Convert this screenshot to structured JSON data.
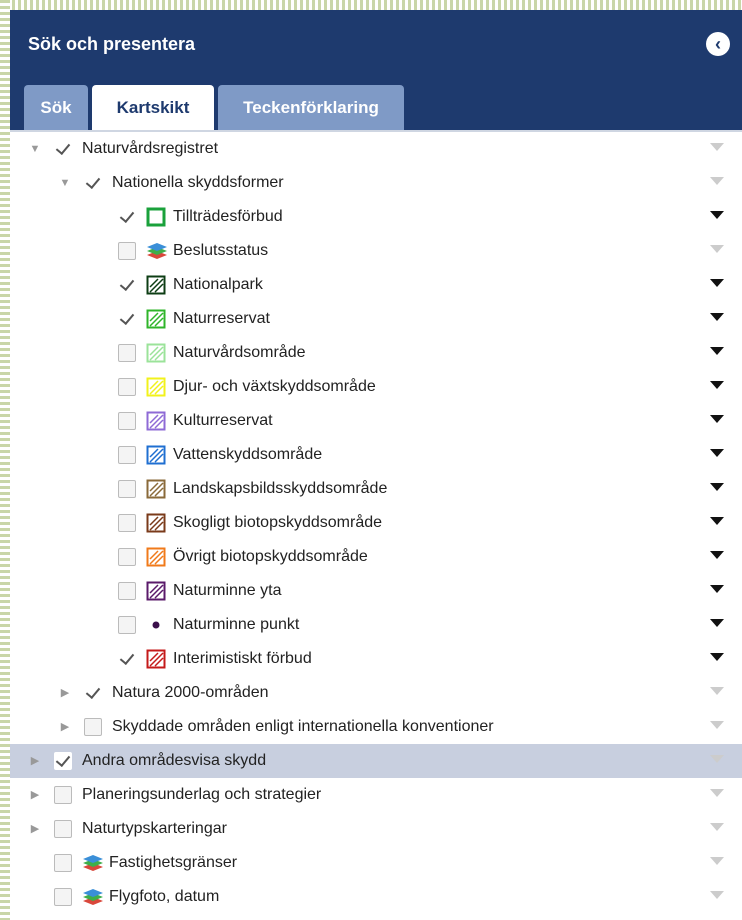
{
  "header": {
    "title": "Sök och presentera",
    "close_icon": "circle-chevron-left-icon"
  },
  "tabs": [
    {
      "label": "Sök",
      "active": false
    },
    {
      "label": "Kartskikt",
      "active": true
    },
    {
      "label": "Teckenförklaring",
      "active": false
    }
  ],
  "tree": [
    {
      "label": "Naturvårdsregistret",
      "level": 0,
      "expander": "expanded",
      "checked": true,
      "symbol": "none",
      "menu": "light"
    },
    {
      "label": "Nationella skyddsformer",
      "level": 1,
      "expander": "expanded",
      "checked": true,
      "symbol": "none",
      "menu": "light"
    },
    {
      "label": "Tillträdesförbud",
      "level": 2,
      "expander": "none",
      "checked": true,
      "symbol": "box",
      "color": "#1aa13b",
      "menu": "dark"
    },
    {
      "label": "Beslutsstatus",
      "level": 2,
      "expander": "none",
      "checked": false,
      "symbol": "layers",
      "menu": "light"
    },
    {
      "label": "Nationalpark",
      "level": 2,
      "expander": "none",
      "checked": true,
      "symbol": "hatch",
      "color": "#0d3d14",
      "menu": "dark"
    },
    {
      "label": "Naturreservat",
      "level": 2,
      "expander": "none",
      "checked": true,
      "symbol": "hatch",
      "color": "#2fb52a",
      "menu": "dark"
    },
    {
      "label": "Naturvårdsområde",
      "level": 2,
      "expander": "none",
      "checked": false,
      "symbol": "hatch",
      "color": "#9be39a",
      "menu": "dark"
    },
    {
      "label": "Djur- och växtskyddsområde",
      "level": 2,
      "expander": "none",
      "checked": false,
      "symbol": "hatch",
      "color": "#f2f21b",
      "menu": "dark"
    },
    {
      "label": "Kulturreservat",
      "level": 2,
      "expander": "none",
      "checked": false,
      "symbol": "hatch",
      "color": "#8e6ad6",
      "menu": "dark"
    },
    {
      "label": "Vattenskyddsområde",
      "level": 2,
      "expander": "none",
      "checked": false,
      "symbol": "hatch",
      "color": "#1f6fd1",
      "menu": "dark"
    },
    {
      "label": "Landskapsbildsskyddsområde",
      "level": 2,
      "expander": "none",
      "checked": false,
      "symbol": "hatch",
      "color": "#8a6a3a",
      "menu": "dark"
    },
    {
      "label": "Skogligt biotopskyddsområde",
      "level": 2,
      "expander": "none",
      "checked": false,
      "symbol": "hatch",
      "color": "#7a3a1a",
      "menu": "dark"
    },
    {
      "label": "Övrigt biotopskyddsområde",
      "level": 2,
      "expander": "none",
      "checked": false,
      "symbol": "hatch",
      "color": "#f07a1a",
      "menu": "dark"
    },
    {
      "label": "Naturminne yta",
      "level": 2,
      "expander": "none",
      "checked": false,
      "symbol": "hatch",
      "color": "#5a1a6a",
      "menu": "dark"
    },
    {
      "label": "Naturminne punkt",
      "level": 2,
      "expander": "none",
      "checked": false,
      "symbol": "dot",
      "color": "#3a0f4a",
      "menu": "dark"
    },
    {
      "label": "Interimistiskt förbud",
      "level": 2,
      "expander": "none",
      "checked": true,
      "symbol": "hatch",
      "color": "#c41a1a",
      "menu": "dark"
    },
    {
      "label": "Natura 2000-områden",
      "level": 1,
      "expander": "collapsed",
      "checked": true,
      "symbol": "none",
      "menu": "light"
    },
    {
      "label": "Skyddade områden enligt internationella konventioner",
      "level": 1,
      "expander": "collapsed",
      "checked": false,
      "symbol": "none",
      "menu": "light"
    },
    {
      "label": "Andra områdesvisa skydd",
      "level": 0,
      "expander": "collapsed",
      "checked": true,
      "symbol": "none",
      "menu": "light",
      "highlight": true
    },
    {
      "label": "Planeringsunderlag och strategier",
      "level": 0,
      "expander": "collapsed",
      "checked": false,
      "symbol": "none",
      "menu": "light"
    },
    {
      "label": "Naturtypskarteringar",
      "level": 0,
      "expander": "collapsed",
      "checked": false,
      "symbol": "none",
      "menu": "light"
    },
    {
      "label": "Fastighetsgränser",
      "level": 0,
      "expander": "none",
      "checked": false,
      "symbol": "layers",
      "menu": "light"
    },
    {
      "label": "Flygfoto, datum",
      "level": 0,
      "expander": "none",
      "checked": false,
      "symbol": "layers",
      "menu": "light"
    }
  ]
}
